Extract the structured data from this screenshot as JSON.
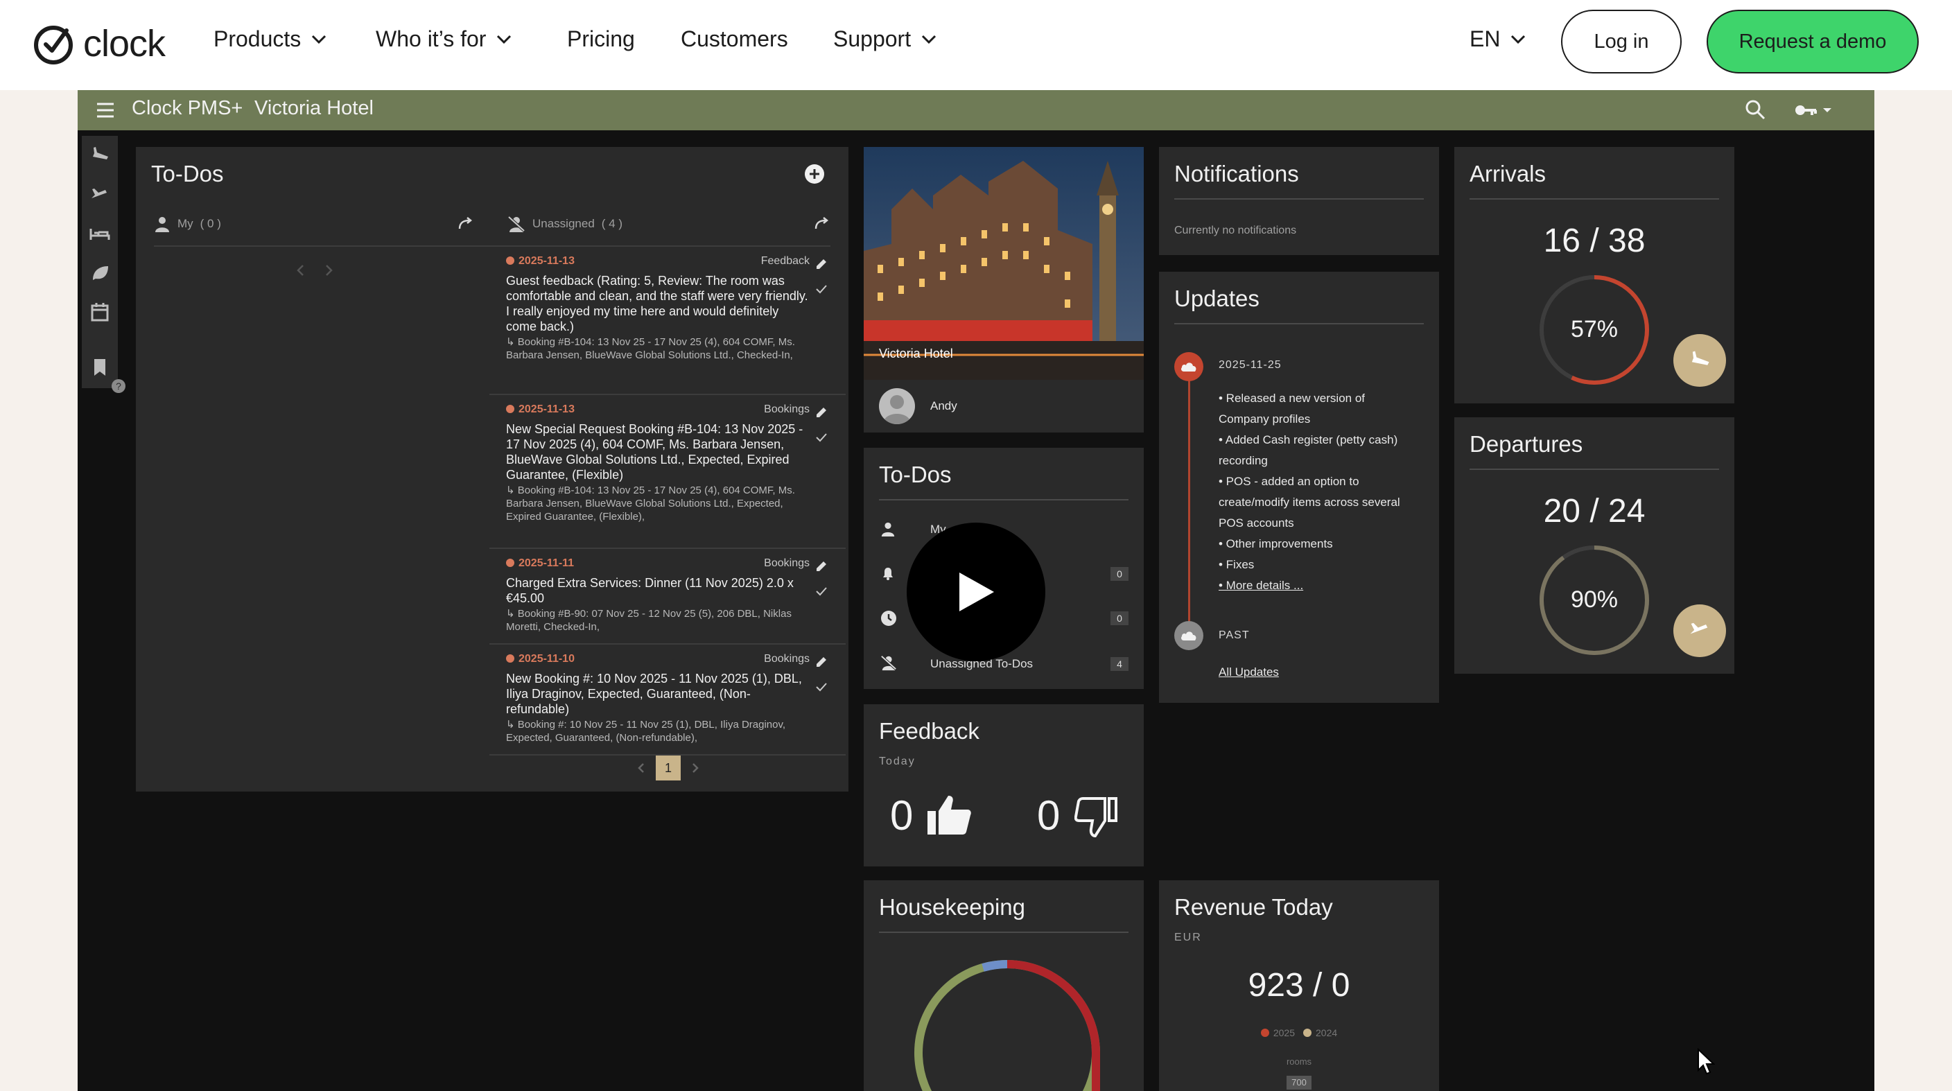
{
  "site": {
    "logo_text": "clock",
    "nav": [
      "Products",
      "Who it’s for",
      "Pricing",
      "Customers",
      "Support"
    ],
    "language": "EN",
    "login_label": "Log in",
    "demo_label": "Request a demo"
  },
  "app": {
    "title": "Clock PMS+",
    "hotel": "Victoria Hotel",
    "todos": {
      "title": "To-Dos",
      "my_label": "My",
      "my_count": "( 0 )",
      "unassigned_label": "Unassigned",
      "unassigned_count": "( 4 )",
      "items": [
        {
          "date": "2025-11-13",
          "category": "Feedback",
          "main": "Guest feedback (Rating: 5, Review: The room was comfortable and clean, and the staff were very friendly. I really enjoyed my time here and would definitely come back.)",
          "sub": "↳ Booking #B-104: 13 Nov 25 - 17 Nov 25 (4), 604 COMF, Ms. Barbara Jensen, BlueWave Global Solutions Ltd., Checked-In,"
        },
        {
          "date": "2025-11-13",
          "category": "Bookings",
          "main": "New Special Request Booking #B-104: 13 Nov 2025 - 17 Nov 2025 (4), 604 COMF, Ms. Barbara Jensen, BlueWave Global Solutions Ltd., Expected, Expired Guarantee, (Flexible)",
          "sub": "↳ Booking #B-104: 13 Nov 25 - 17 Nov 25 (4), 604 COMF, Ms. Barbara Jensen, BlueWave Global Solutions Ltd., Expected, Expired Guarantee, (Flexible),"
        },
        {
          "date": "2025-11-11",
          "category": "Bookings",
          "main": "Charged Extra Services: Dinner (11 Nov 2025) 2.0 x €45.00",
          "sub": "↳ Booking #B-90: 07 Nov 25 - 12 Nov 25 (5), 206 DBL, Niklas Moretti, Checked-In,"
        },
        {
          "date": "2025-11-10",
          "category": "Bookings",
          "main": "New Booking #: 10 Nov 2025 - 11 Nov 2025 (1), DBL, Iliya Draginov, Expected, Guaranteed, (Non-refundable)",
          "sub": "↳ Booking #: 10 Nov 25 - 11 Nov 25 (1), DBL, Iliya Draginov, Expected, Guaranteed, (Non-refundable),"
        }
      ],
      "page": "1"
    },
    "hotel_card": {
      "caption": "Victoria Hotel",
      "user": "Andy"
    },
    "todos_small": {
      "title": "To-Dos",
      "row1_label": "My",
      "row2_count": "0",
      "row3_count": "0",
      "row4_label": "Unassigned To-Dos",
      "row4_count": "4"
    },
    "feedback": {
      "title": "Feedback",
      "period": "Today",
      "positive": "0",
      "negative": "0"
    },
    "notifications": {
      "title": "Notifications",
      "empty": "Currently no notifications"
    },
    "updates": {
      "title": "Updates",
      "date": "2025-11-25",
      "lines": [
        "• Released a new version of",
        "Company profiles",
        "• Added Cash register (petty cash)",
        "recording",
        "• POS - added an option to",
        "create/modify items across several",
        "POS accounts",
        "• Other improvements",
        "• Fixes"
      ],
      "more": "• More details ...",
      "past": "PAST",
      "all": "All Updates"
    },
    "arrivals": {
      "title": "Arrivals",
      "count": "16 / 38",
      "percent": "57%",
      "fraction": 0.57
    },
    "departures": {
      "title": "Departures",
      "count": "20 / 24",
      "percent": "90%",
      "fraction": 0.9
    },
    "housekeeping": {
      "title": "Housekeeping"
    },
    "revenue": {
      "title": "Revenue Today",
      "currency": "EUR",
      "value": "923 / 0",
      "legend": [
        "2025",
        "2024"
      ],
      "axis_label": "rooms",
      "tick": "700"
    },
    "colors": {
      "accent_bar": "#6f7b56",
      "ring_arrivals": "#c4452f",
      "ring_departures": "#b15a3a",
      "demo_green": "#3ed46b",
      "action_gold": "#c9b48a"
    }
  }
}
